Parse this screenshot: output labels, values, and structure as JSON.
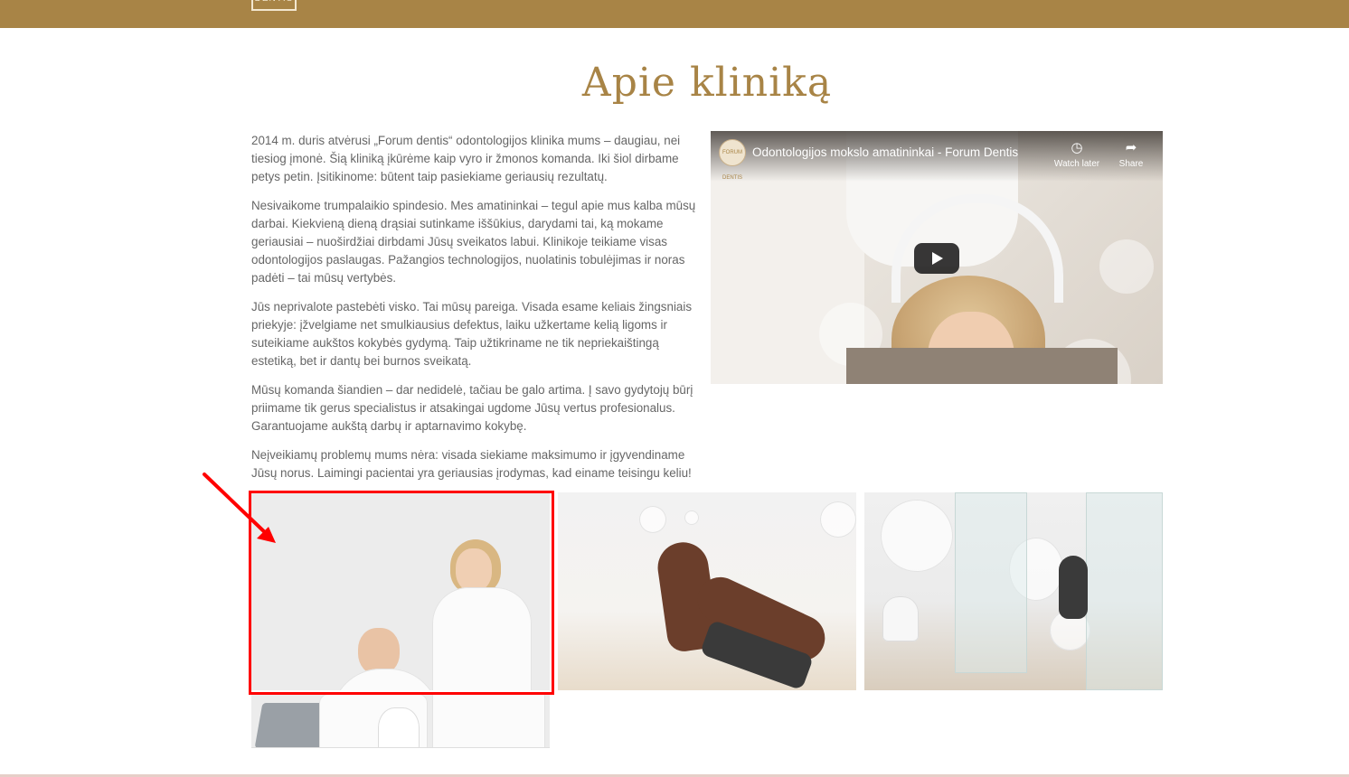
{
  "header": {
    "logo_text": "DENTIS",
    "background_color": "#a88446"
  },
  "main": {
    "title": "Apie kliniką",
    "paragraphs": [
      "2014 m. duris atvėrusi „Forum dentis“ odontologijos klinika mums – daugiau, nei tiesiog įmonė. Šią kliniką įkūrėme kaip vyro ir žmonos komanda. Iki šiol dirbame petys petin. Įsitikinome: būtent taip pasiekiame geriausių rezultatų.",
      "Nesivaikome trumpalaikio spindesio. Mes amatininkai – tegul apie mus kalba mūsų darbai. Kiekvieną dieną drąsiai sutinkame iššūkius, darydami tai, ką mokame geriausiai – nuoširdžiai dirbdami Jūsų sveikatos labui. Klinikoje teikiame visas odontologijos paslaugas. Pažangios technologijos, nuolatinis tobulėjimas ir noras padėti – tai mūsų vertybės.",
      "Jūs neprivalote pastebėti visko. Tai mūsų pareiga. Visada esame keliais žingsniais priekyje:  įžvelgiame net smulkiausius defektus, laiku užkertame kelią ligoms ir suteikiame aukštos kokybės gydymą. Taip užtikriname ne tik nepriekaištingą estetiką, bet ir dantų bei burnos sveikatą.",
      "Mūsų komanda šiandien – dar nedidelė, tačiau be galo artima. Į savo gydytojų būrį priimame tik gerus specialistus ir atsakingai ugdome Jūsų vertus profesionalus. Garantuojame aukštą darbų ir aptarnavimo kokybę.",
      "Neįveikiamų problemų mums nėra: visada siekiame maksimumo ir įgyvendiname Jūsų norus. Laimingi pacientai yra geriausias įrodymas, kad einame teisingu keliu!"
    ]
  },
  "video": {
    "channel_avatar_text": "FORUM DENTIS",
    "title": "Odontologijos mokslo amatininkai - Forum Dentis",
    "watch_later_label": "Watch later",
    "share_label": "Share",
    "watch_later_icon": "clock-icon",
    "share_icon": "share-arrow-icon",
    "play_icon": "play-icon"
  },
  "gallery": {
    "images": [
      "team-photo",
      "dental-chair-photo",
      "clinic-room-photo",
      "team-photo-bottom"
    ]
  },
  "annotation": {
    "highlight_color": "#ff0000"
  }
}
